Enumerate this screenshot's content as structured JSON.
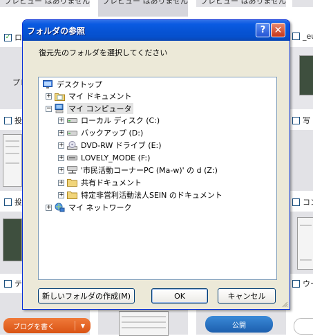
{
  "background": {
    "preview_texts": [
      "プレビュー はありません",
      "プレビュー はありません",
      "プレビュー はありません"
    ],
    "side_labels": [
      "プレ"
    ],
    "checkbox_labels": [
      "ロ",
      "_eu",
      "投",
      "写",
      "投",
      "コン",
      "テ",
      "ウー"
    ],
    "blog_button": "ブログを書く",
    "publish_button": "公開"
  },
  "dialog": {
    "title": "フォルダの参照",
    "help_glyph": "?",
    "close_glyph": "✕",
    "prompt": "復元先のフォルダを選択してください",
    "tree": [
      {
        "label": "デスクトップ",
        "icon": "desktop-icon",
        "expander": ""
      },
      {
        "label": "マイ ドキュメント",
        "icon": "my-documents-icon",
        "expander": "+"
      },
      {
        "label": "マイ コンピュータ",
        "icon": "my-computer-icon",
        "expander": "−"
      },
      {
        "label": "ローカル ディスク (C:)",
        "icon": "hard-disk-icon",
        "expander": "+"
      },
      {
        "label": "バックアップ (D:)",
        "icon": "hard-disk-icon",
        "expander": "+"
      },
      {
        "label": "DVD-RW ドライブ (E:)",
        "icon": "dvd-drive-icon",
        "expander": "+"
      },
      {
        "label": "LOVELY_MODE (F:)",
        "icon": "removable-disk-icon",
        "expander": "+"
      },
      {
        "label": "'市民活動コーナーPC (Ma-w)' の d (Z:)",
        "icon": "network-drive-icon",
        "expander": "+"
      },
      {
        "label": "共有ドキュメント",
        "icon": "folder-icon",
        "expander": "+"
      },
      {
        "label": "特定非営利活動法人SEIN のドキュメント",
        "icon": "folder-icon",
        "expander": "+"
      },
      {
        "label": "マイ ネットワーク",
        "icon": "my-network-icon",
        "expander": "+"
      }
    ],
    "buttons": {
      "new_folder": "新しいフォルダの作成(M)",
      "ok": "OK",
      "cancel": "キャンセル"
    }
  },
  "colors": {
    "titlebar": "#0754d6",
    "dialog_face": "#ece9d8",
    "close_button": "#c4351a",
    "blog_button": "#e0601e",
    "publish_button": "#1d5fae"
  }
}
